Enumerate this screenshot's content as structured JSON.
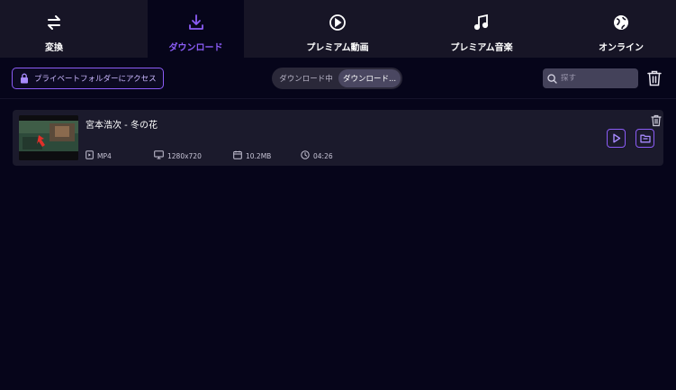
{
  "nav": {
    "items": [
      {
        "label": "変換",
        "icon": "swap-arrows-icon"
      },
      {
        "label": "ダウンロード",
        "icon": "download-icon",
        "active": true
      },
      {
        "label": "プレミアム動画",
        "icon": "play-circle-icon"
      },
      {
        "label": "プレミアム音楽",
        "icon": "music-note-icon"
      },
      {
        "label": "オンライン",
        "icon": "globe-icon"
      }
    ]
  },
  "toolbar": {
    "private_folder_label": "プライベートフォルダーにアクセス",
    "tabs": [
      "ダウンロード中",
      "ダウンロード..."
    ],
    "active_tab": 1,
    "search_placeholder": "探す"
  },
  "items": [
    {
      "title": "宮本浩次 - 冬の花",
      "format": "MP4",
      "resolution": "1280x720",
      "size": "10.2MB",
      "duration": "04:26"
    }
  ],
  "colors": {
    "accent": "#8b5cf6",
    "background": "#06051a",
    "nav_background": "#171526",
    "card_background": "#1b1a2c"
  }
}
